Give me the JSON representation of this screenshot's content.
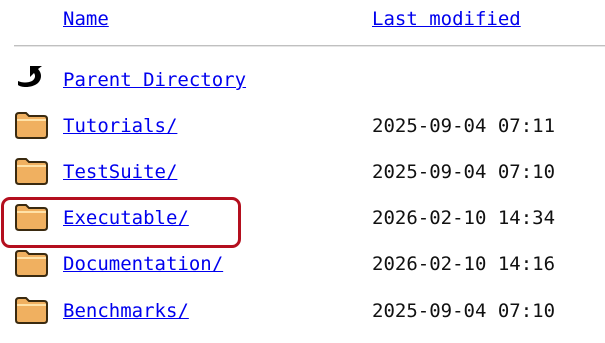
{
  "header": {
    "name_label": "Name",
    "last_modified_label": "Last modified"
  },
  "parent": {
    "label": "Parent Directory",
    "icon": "back-arrow-icon"
  },
  "entries": [
    {
      "name": "Tutorials/",
      "modified": "2025-09-04 07:11",
      "icon": "folder-icon"
    },
    {
      "name": "TestSuite/",
      "modified": "2025-09-04 07:10",
      "icon": "folder-icon"
    },
    {
      "name": "Executable/",
      "modified": "2026-02-10 14:34",
      "icon": "folder-icon",
      "highlighted": true
    },
    {
      "name": "Documentation/",
      "modified": "2026-02-10 14:16",
      "icon": "folder-icon"
    },
    {
      "name": "Benchmarks/",
      "modified": "2025-09-04 07:10",
      "icon": "folder-icon"
    }
  ],
  "colors": {
    "link": "#0000ee",
    "highlight_border": "#b40f1e",
    "folder_fill": "#f0b060"
  }
}
